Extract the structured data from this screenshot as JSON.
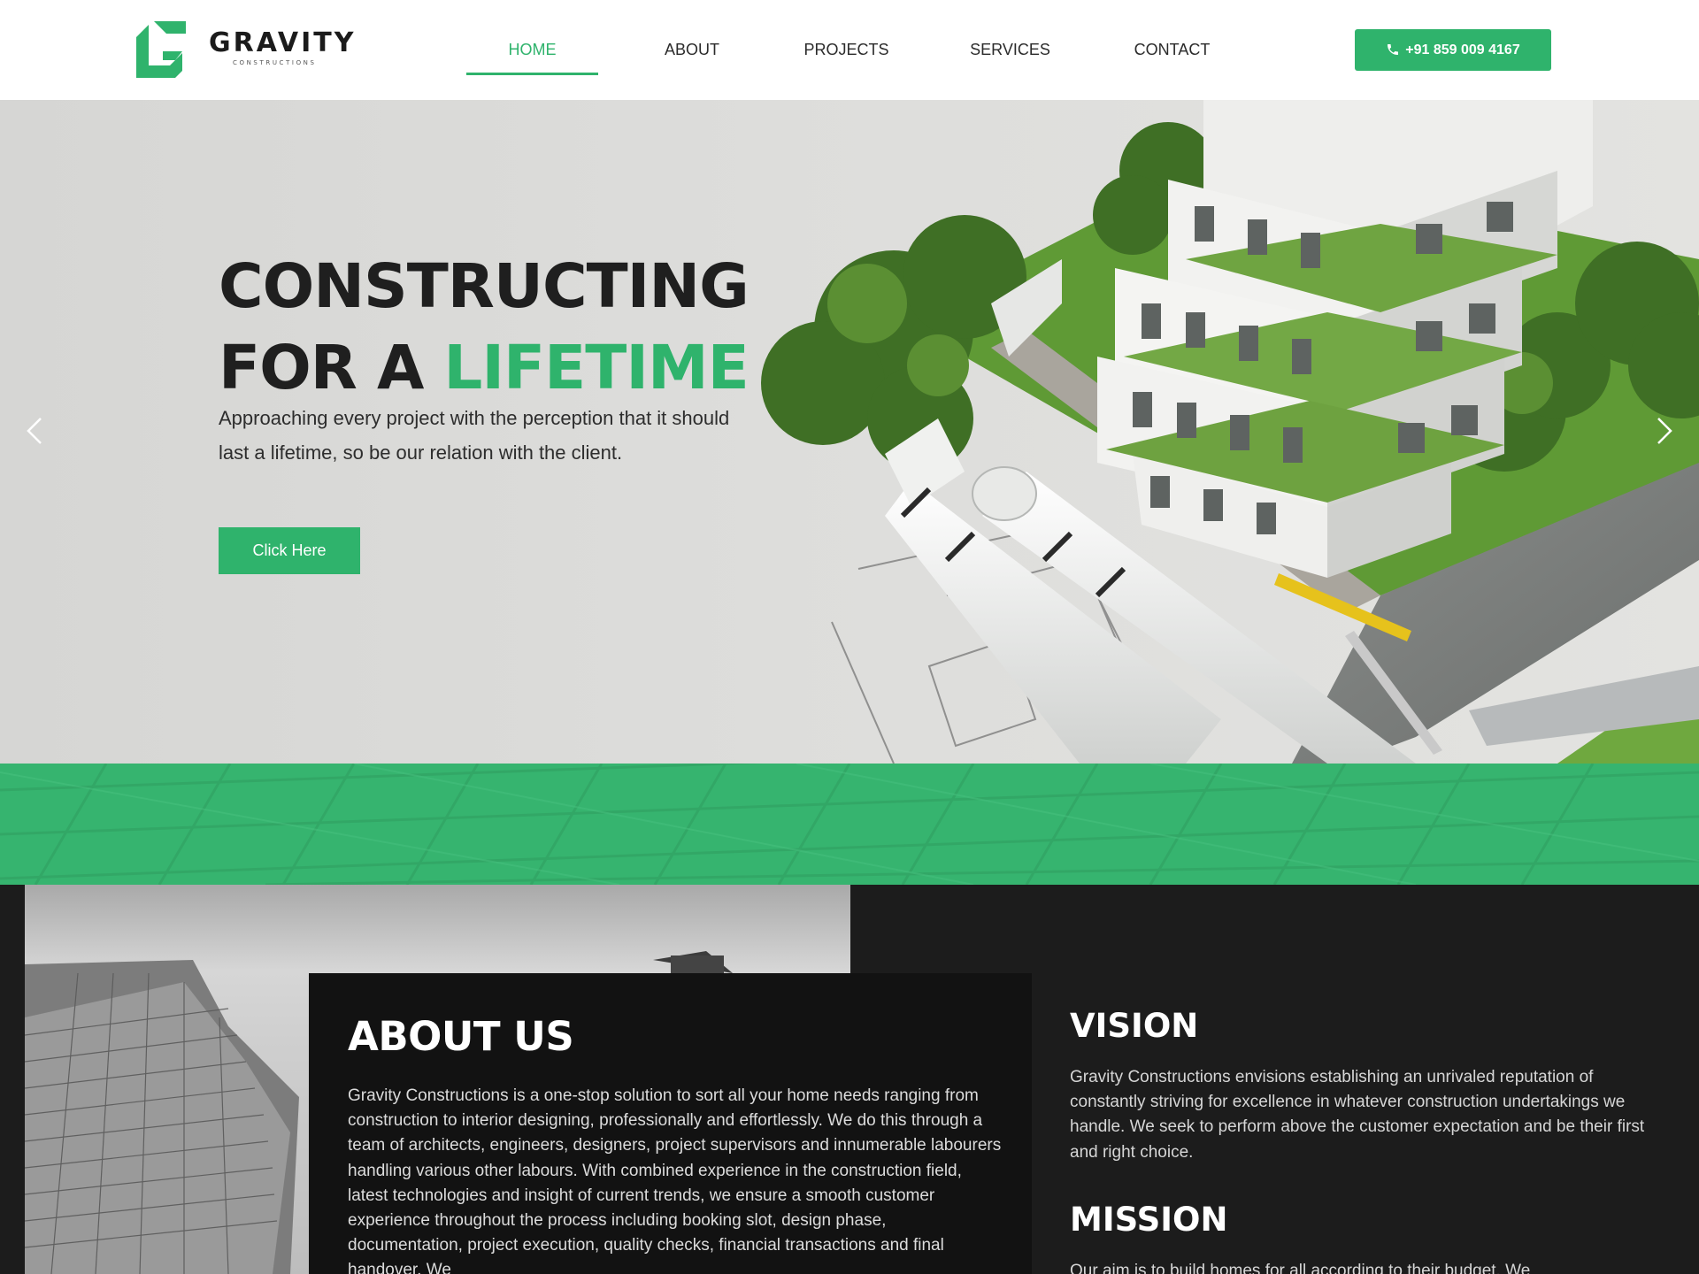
{
  "brand": {
    "name": "GRAVITY",
    "tagline": "CONSTRUCTIONS",
    "green": "#2fb36c"
  },
  "nav": {
    "items": [
      {
        "label": "HOME",
        "active": true
      },
      {
        "label": "ABOUT",
        "active": false
      },
      {
        "label": "PROJECTS",
        "active": false
      },
      {
        "label": "SERVICES",
        "active": false
      },
      {
        "label": "CONTACT",
        "active": false
      }
    ],
    "phone": "+91 859 009 4167",
    "phone_icon": "phone-icon"
  },
  "hero": {
    "title_line1": "CONSTRUCTING",
    "title_line2_prefix": "FOR A ",
    "title_line2_accent": "LIFETIME",
    "description": "Approaching every project with the perception that it should last a lifetime, so be our relation with the client.",
    "cta_label": "Click Here",
    "prev_icon": "chevron-left-icon",
    "next_icon": "chevron-right-icon"
  },
  "about": {
    "title": "ABOUT US",
    "text": "Gravity Constructions is a one-stop solution to sort all your home needs ranging from construction to interior designing, professionally and effortlessly. We do this through a team of architects, engineers, designers, project supervisors and innumerable labourers handling various other labours. With combined experience in the construction field, latest technologies and insight of current trends, we ensure a smooth customer experience throughout the process including booking slot, design phase, documentation, project execution, quality checks, financial transactions and final handover. We"
  },
  "vision": {
    "title": "VISION",
    "text": "Gravity Constructions envisions establishing an unrivaled reputation of constantly striving for excellence in whatever construction undertakings we handle. We seek to perform above the customer expectation and be their first and right choice."
  },
  "mission": {
    "title": "MISSION",
    "text": "Our aim is to build homes for all according to their budget. We"
  }
}
